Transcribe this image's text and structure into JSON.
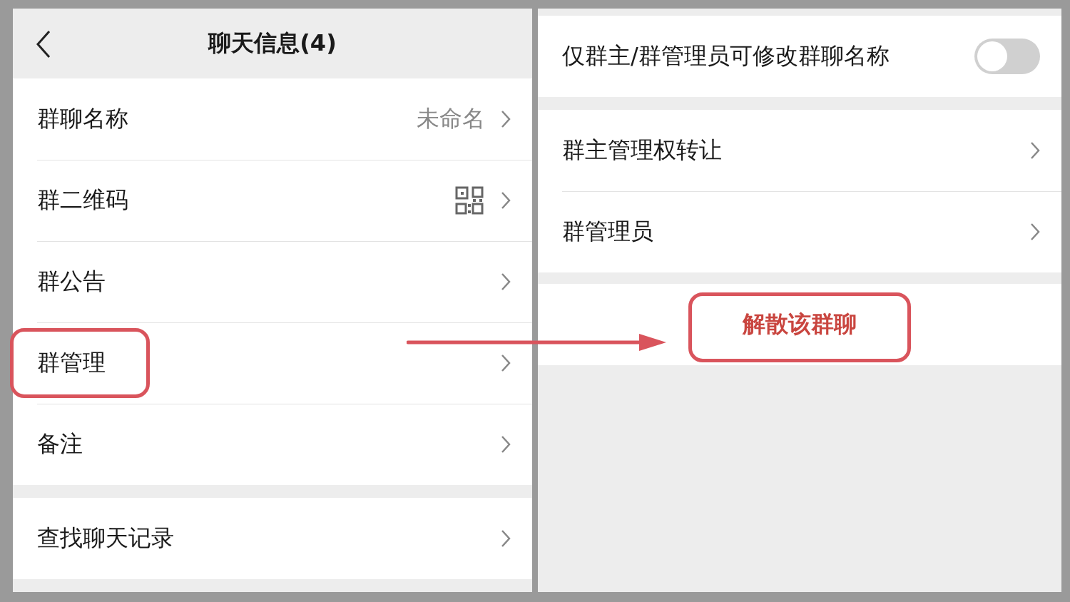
{
  "left": {
    "header": {
      "title": "聊天信息(4)"
    },
    "groups": [
      {
        "items": [
          {
            "label": "群聊名称",
            "kind": "value",
            "value": "未命名",
            "highlighted": false
          },
          {
            "label": "群二维码",
            "kind": "qr",
            "highlighted": false
          },
          {
            "label": "群公告",
            "kind": "plain",
            "highlighted": false
          },
          {
            "label": "群管理",
            "kind": "plain",
            "highlighted": true
          },
          {
            "label": "备注",
            "kind": "plain",
            "highlighted": false
          }
        ]
      },
      {
        "items": [
          {
            "label": "查找聊天记录",
            "kind": "plain",
            "highlighted": false
          }
        ]
      }
    ]
  },
  "right": {
    "groups": [
      {
        "items": [
          {
            "label": "仅群主/群管理员可修改群聊名称",
            "kind": "toggle",
            "on": false
          }
        ]
      },
      {
        "items": [
          {
            "label": "群主管理权转让",
            "kind": "plain"
          },
          {
            "label": "群管理员",
            "kind": "plain"
          }
        ]
      }
    ],
    "danger_button": {
      "label": "解散该群聊",
      "highlighted": true
    }
  }
}
